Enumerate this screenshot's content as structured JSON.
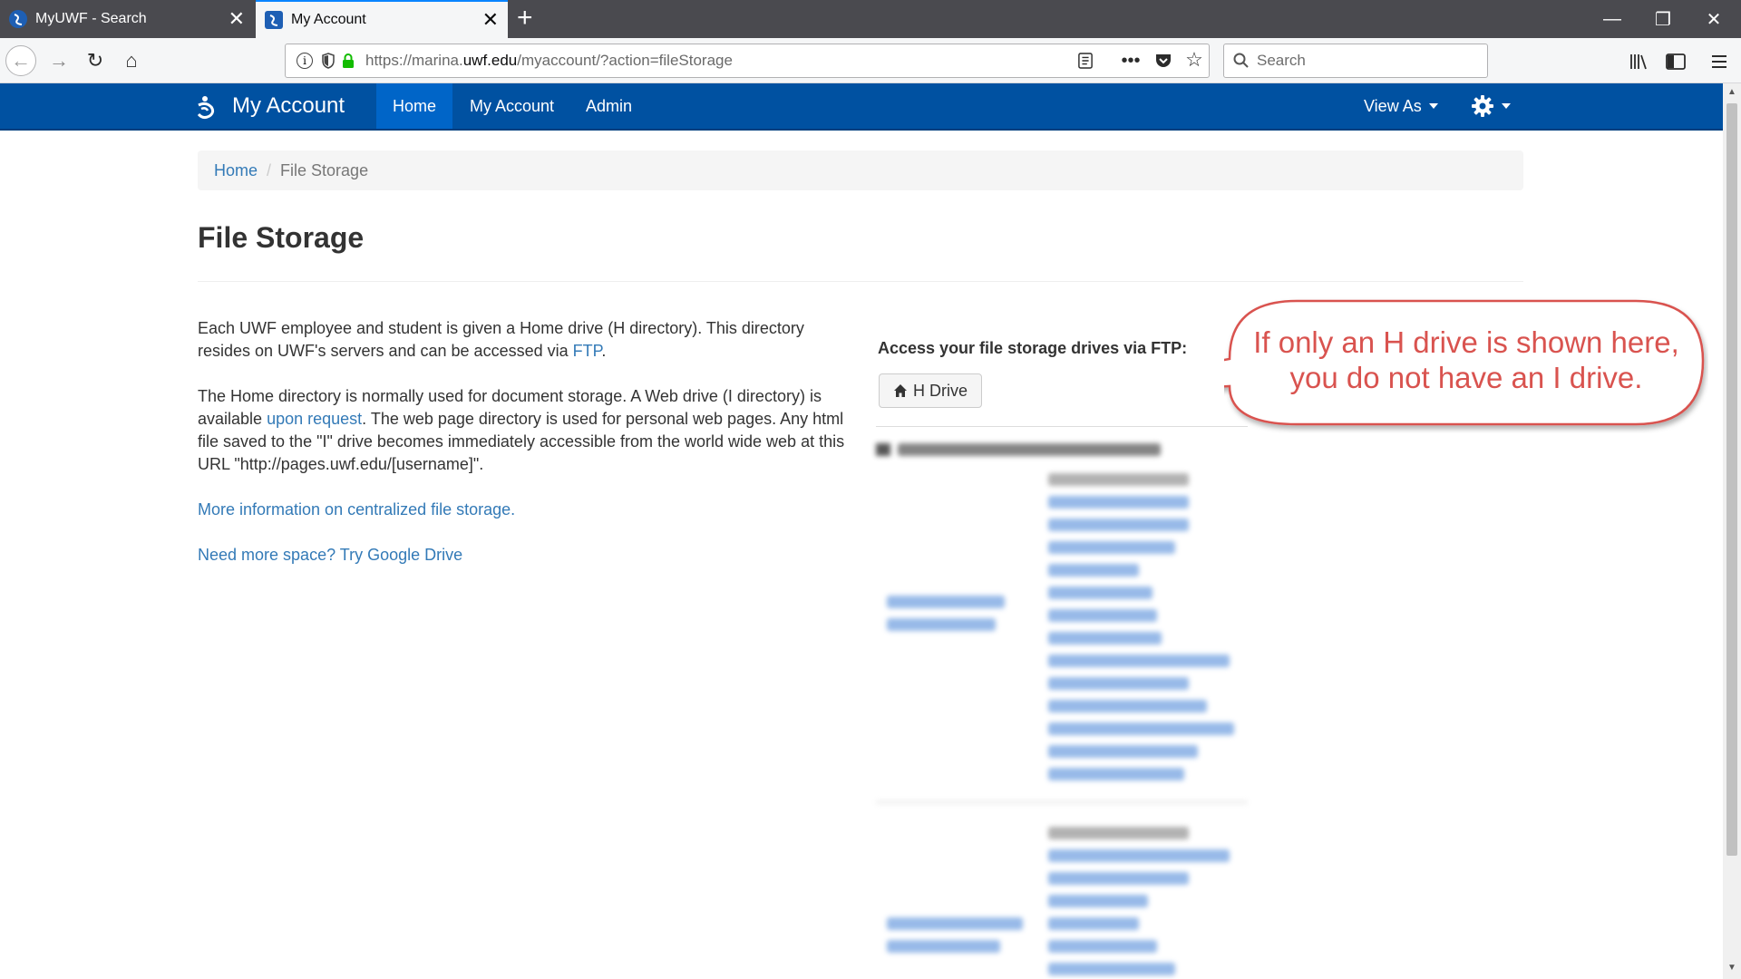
{
  "browser": {
    "tabs": [
      {
        "title": "MyUWF - Search",
        "active": false
      },
      {
        "title": "My Account",
        "active": true
      }
    ],
    "url_prefix": "https://marina.",
    "url_domain": "uwf.edu",
    "url_suffix": "/myaccount/?action=fileStorage",
    "search_placeholder": "Search"
  },
  "site": {
    "brand": "My Account",
    "nav": [
      {
        "label": "Home",
        "active": true
      },
      {
        "label": "My Account",
        "active": false
      },
      {
        "label": "Admin",
        "active": false
      }
    ],
    "view_as": "View As"
  },
  "breadcrumb": {
    "home": "Home",
    "current": "File Storage"
  },
  "page_title": "File Storage",
  "intro": {
    "p1_a": "Each UWF employee and student is given a Home drive (H directory). This directory resides on UWF's servers and can be accessed via ",
    "p1_link": "FTP",
    "p1_b": ".",
    "p2_a": "The Home directory is normally used for document storage. A Web drive (I directory) is available ",
    "p2_link": "upon request",
    "p2_b": ". The web page directory is used for personal web pages. Any html file saved to the \"I\" drive becomes immediately accessible from the world wide web at this URL \"http://pages.uwf.edu/[username]\".",
    "more_info_link": "More information on centralized file storage.",
    "google_drive_link": "Need more space? Try Google Drive"
  },
  "ftp": {
    "label": "Access your file storage drives via FTP:",
    "h_drive_button": "H Drive"
  },
  "callout": {
    "line1": "If only an H drive is shown here,",
    "line2": "you do not have an I drive."
  },
  "colors": {
    "site_nav": "#0051a1",
    "site_nav_active": "#0065c8",
    "link": "#337ab7",
    "callout": "#d9534f"
  }
}
